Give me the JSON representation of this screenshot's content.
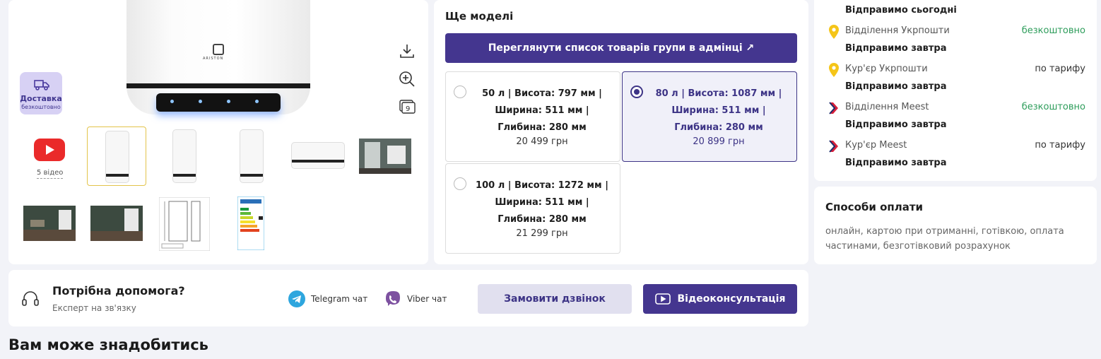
{
  "gallery": {
    "badge_line1": "Доставка",
    "badge_line2": "безкоштовно",
    "video_count": "5 відео"
  },
  "models": {
    "title": "Ще моделі",
    "admin_button": "Переглянути список товарів групи в адмінці ↗",
    "variants": [
      {
        "line1": "50 л | Висота: 797 мм |",
        "line2": "Ширина: 511 мм |",
        "line3": "Глибина: 280 мм",
        "price": "20 499 грн",
        "selected": false
      },
      {
        "line1": "80 л | Висота: 1087 мм |",
        "line2": "Ширина: 511 мм |",
        "line3": "Глибина: 280 мм",
        "price": "20 899 грн",
        "selected": true
      },
      {
        "line1": "100 л | Висота: 1272 мм |",
        "line2": "Ширина: 511 мм |",
        "line3": "Глибина: 280 мм",
        "price": "21 299 грн",
        "selected": false
      }
    ]
  },
  "delivery": {
    "top_when": "Відправимо сьогодні",
    "options": [
      {
        "name": "Відділення Укрпошти",
        "price": "безкоштовно",
        "when": "Відправимо завтра",
        "icon": "ukrposhta-pin-icon"
      },
      {
        "name": "Кур'єр Укрпошти",
        "price": "по тарифу",
        "when": "Відправимо завтра",
        "icon": "ukrposhta-pin-icon"
      },
      {
        "name": "Відділення Meest",
        "price": "безкоштовно",
        "when": "Відправимо завтра",
        "icon": "meest-logo-icon"
      },
      {
        "name": "Кур'єр Meest",
        "price": "по тарифу",
        "when": "Відправимо завтра",
        "icon": "meest-logo-icon"
      }
    ]
  },
  "payment": {
    "title": "Способи оплати",
    "text": "онлайн, картою при отриманні, готівкою, оплата частинами, безготівковий розрахунок"
  },
  "help": {
    "title": "Потрібна допомога?",
    "subtitle": "Експерт на зв'язку",
    "telegram": "Telegram чат",
    "viber": "Viber чат",
    "call_button": "Замовити дзвінок",
    "video_button": "Відеоконсультація"
  },
  "section_title": "Вам може знадобитись",
  "colors": {
    "primary": "#44368f",
    "free": "#2e9d5b",
    "youtube": "#ea2a2a"
  }
}
